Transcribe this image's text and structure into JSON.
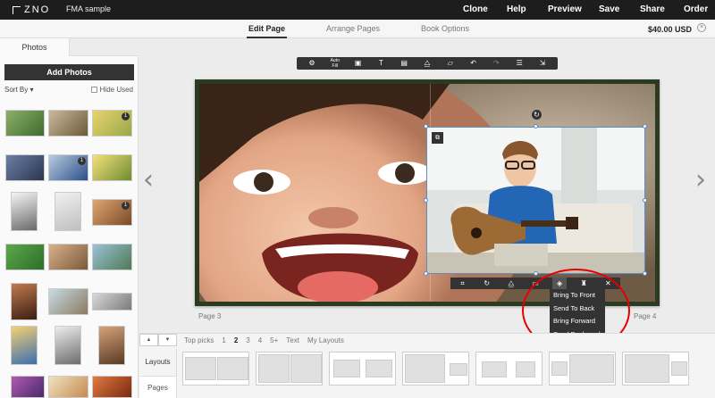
{
  "app": {
    "logo_text": "ZNO",
    "project_name": "FMA sample"
  },
  "topnav": {
    "clone": "Clone",
    "help": "Help",
    "preview": "Preview",
    "save": "Save",
    "share": "Share",
    "order": "Order"
  },
  "tabs": {
    "edit_page": "Edit Page",
    "arrange_pages": "Arrange Pages",
    "book_options": "Book Options"
  },
  "price": "$40.00 USD",
  "price_close": "×",
  "sidebar": {
    "photos_tab": "Photos",
    "add_photos": "Add Photos",
    "sort_by": "Sort By ▾",
    "hide_used": "Hide Used",
    "badges": [
      "1",
      "1",
      "1"
    ]
  },
  "toolbar": {
    "settings": "⚙",
    "auto_fill": "Auto Fill",
    "image": "▣",
    "text": "T",
    "layer": "▤",
    "mirror": "⧋",
    "sticker": "▱",
    "undo": "↶",
    "redo": "↷",
    "clear": "☰",
    "export": "⇲"
  },
  "canvas": {
    "page_left": "Page 3",
    "page_right": "Page 4",
    "arrow_left": "‹",
    "arrow_right": "›",
    "rotate": "↻",
    "swap": "⧉"
  },
  "photo_toolbar": {
    "crop": "⌗",
    "rotate": "↻",
    "flip": "⧋",
    "fit": "▭",
    "arrange": "◈",
    "filter": "♜",
    "delete": "✕"
  },
  "arrange_menu": {
    "bring_to_front": "Bring To Front",
    "send_to_back": "Send To Back",
    "bring_forward": "Bring Forward",
    "send_backward": "Send Backward"
  },
  "bottom": {
    "nav_up": "▲",
    "nav_down": "▼",
    "filters": {
      "top_picks": "Top picks",
      "p1": "1",
      "p2": "2",
      "p3": "3",
      "p4": "4",
      "p5": "5+",
      "text": "Text",
      "my_layouts": "My Layouts"
    },
    "layouts_label": "Layouts",
    "pages_label": "Pages"
  },
  "colors": {
    "topbar": "#1d1d1d",
    "selection": "#5b8cc7",
    "highlight_circle": "#e60000",
    "book_cover": "#2a3b22"
  }
}
